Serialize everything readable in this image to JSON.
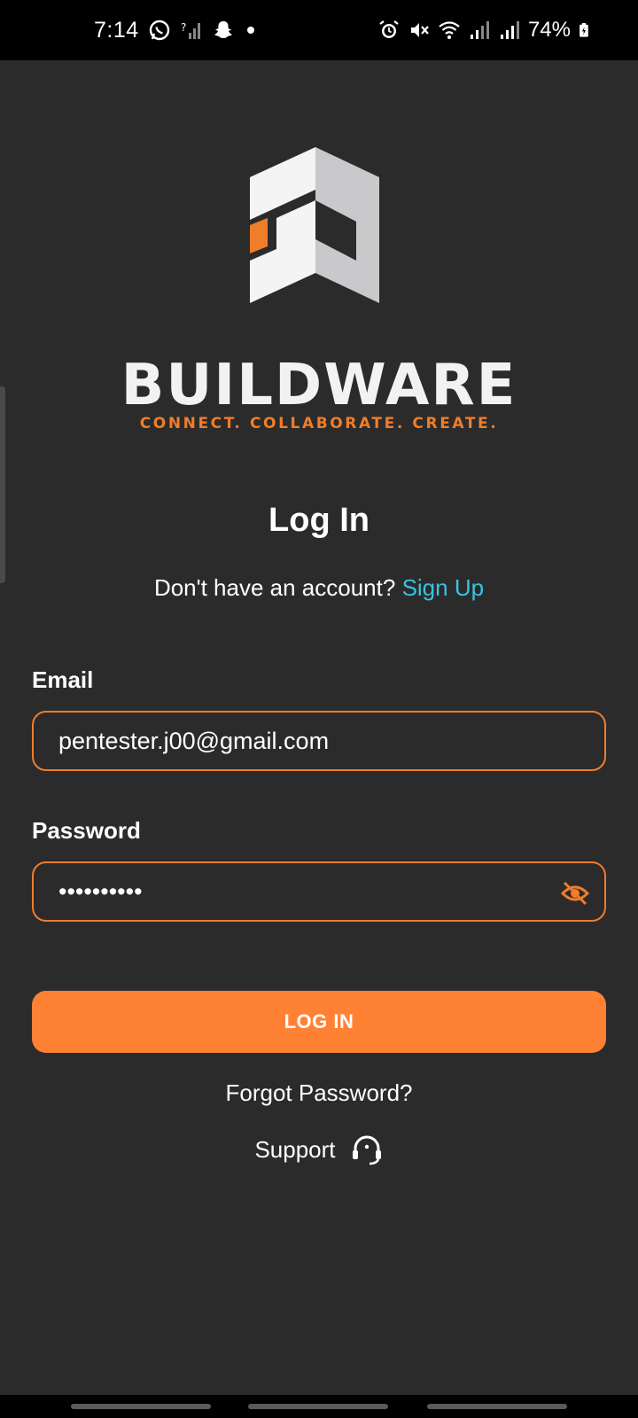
{
  "status_bar": {
    "time": "7:14",
    "battery": "74%",
    "left_icons": [
      "whatsapp-icon",
      "signal-unknown-icon",
      "snapchat-icon",
      "notification-dot"
    ],
    "right_icons": [
      "alarm-icon",
      "mute-icon",
      "wifi-icon",
      "signal-icon",
      "signal-icon",
      "battery-charging-icon"
    ]
  },
  "brand": {
    "name": "BUILDWARE",
    "tagline": "CONNECT. COLLABORATE. CREATE.",
    "accent_color": "#f07d2a"
  },
  "screen": {
    "title": "Log In",
    "signup_prompt": "Don't have an account?",
    "signup_link": "Sign Up"
  },
  "form": {
    "email_label": "Email",
    "email_value": "pentester.j00@gmail.com",
    "password_label": "Password",
    "password_value": "••••••••••",
    "password_toggle_icon": "eye-off-icon"
  },
  "actions": {
    "login_button": "LOG IN",
    "forgot_password": "Forgot Password?",
    "support": "Support",
    "support_icon": "headset-icon"
  },
  "colors": {
    "background": "#2b2b2c",
    "primary": "#ff8234",
    "link": "#39c3e0"
  }
}
